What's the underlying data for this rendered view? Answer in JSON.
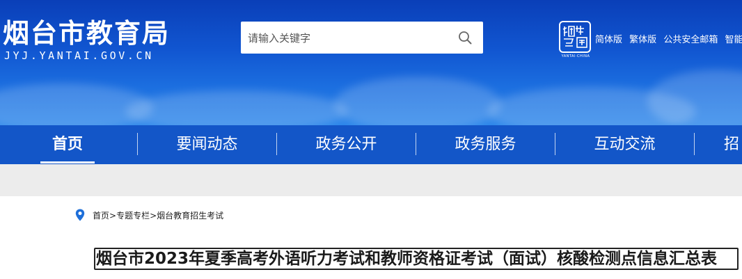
{
  "header": {
    "site_title": "烟台市教育局",
    "site_domain": "JYJ.YANTAI.GOV.CN",
    "search": {
      "placeholder": "请输入关键字"
    },
    "seal_caption": "YANTAI·CHINA",
    "top_links": [
      "简体版",
      "繁体版",
      "公共安全邮箱",
      "智能"
    ]
  },
  "nav": {
    "items": [
      "首页",
      "要闻动态",
      "政务公开",
      "政务服务",
      "互动交流",
      "招"
    ],
    "active_index": 0
  },
  "breadcrumb": {
    "items": [
      "首页",
      "专题专栏",
      "烟台教育招生考试"
    ],
    "separator": ">"
  },
  "article": {
    "title": "烟台市2023年夏季高考外语听力考试和教师资格证考试（面试）核酸检测点信息汇总表"
  },
  "colors": {
    "banner": "#1156d1",
    "nav": "#1356c8",
    "band": "#ececec",
    "pin": "#1e6fd9"
  }
}
